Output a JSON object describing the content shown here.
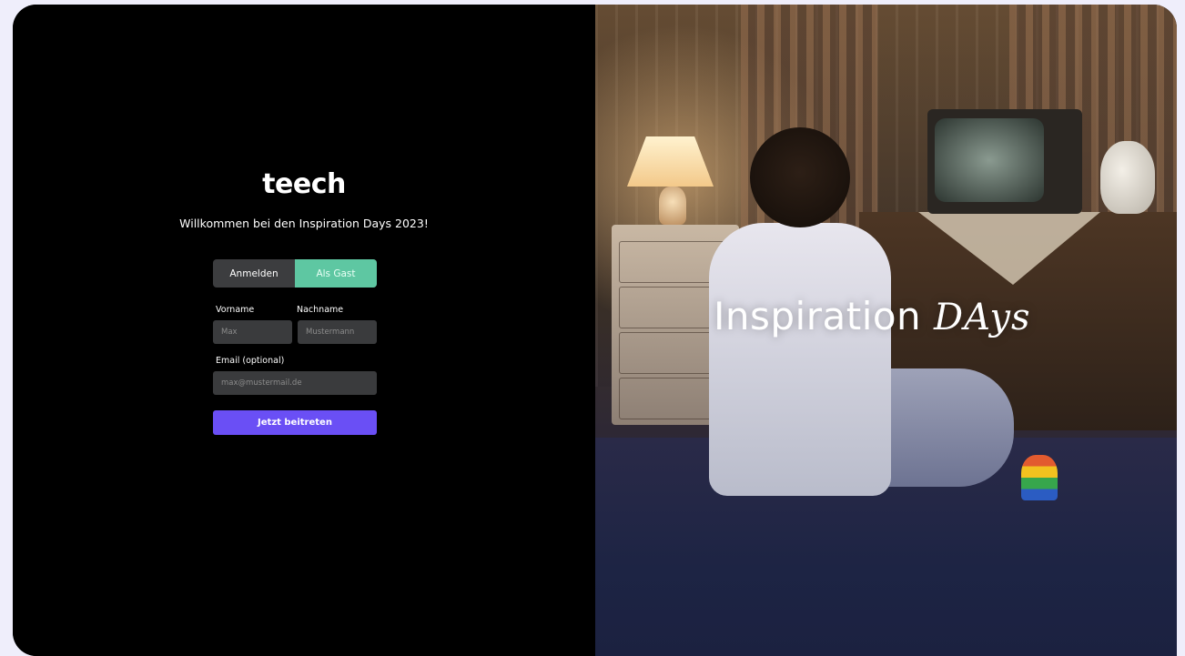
{
  "brand": {
    "logo": "teech"
  },
  "welcome": {
    "title": "Willkommen bei den Inspiration Days 2023!"
  },
  "tabs": [
    {
      "label": "Anmelden",
      "active": false
    },
    {
      "label": "Als Gast",
      "active": true
    }
  ],
  "form": {
    "first_name_label": "Vorname",
    "first_name_placeholder": "Max",
    "last_name_label": "Nachname",
    "last_name_placeholder": "Mustermann",
    "email_label": "Email (optional)",
    "email_placeholder": "max@mustermail.de",
    "submit_label": "Jetzt beitreten"
  },
  "hero": {
    "title_main": "Inspiration",
    "title_script": "DAys"
  },
  "colors": {
    "accent_tab": "#5ec7a2",
    "submit_button": "#6a4ff5",
    "panel_background": "#000000",
    "page_background": "#efeefb"
  }
}
